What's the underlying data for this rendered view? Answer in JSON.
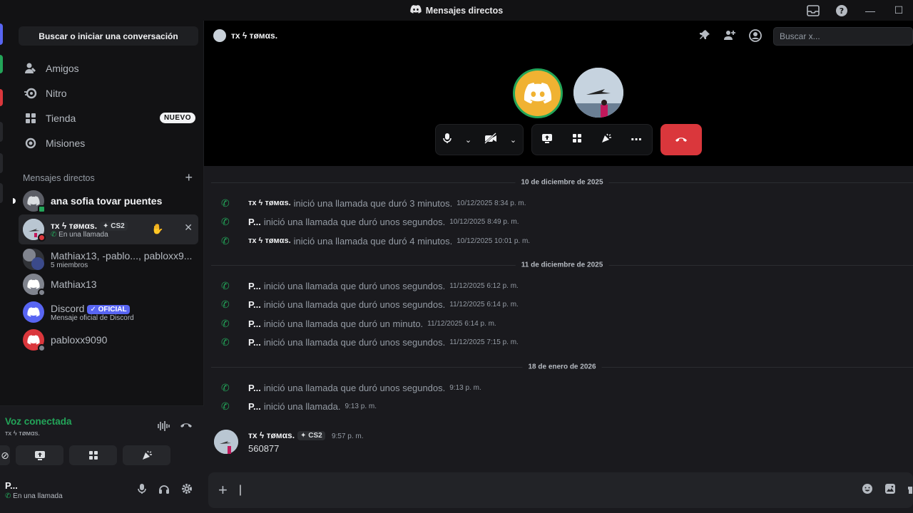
{
  "window": {
    "title": "Mensajes directos"
  },
  "sidebar": {
    "search_label": "Buscar o iniciar una conversación",
    "nav": [
      {
        "label": "Amigos",
        "icon": "friends-icon"
      },
      {
        "label": "Nitro",
        "icon": "nitro-icon"
      },
      {
        "label": "Tienda",
        "icon": "shop-icon",
        "badge": "NUEVO"
      },
      {
        "label": "Misiones",
        "icon": "quests-icon"
      }
    ],
    "dm_header": "Mensajes directos",
    "dms": [
      {
        "name": "ana sofia tovar puentes",
        "status_color": "#23a559"
      },
      {
        "name": "тx ϟ тøмαѕ.",
        "tag": "CS2",
        "sub": "En una llamada",
        "status_color": "#da373c"
      },
      {
        "name": "Mathiax13, -pablo..., pabloxx9...",
        "sub": "5 miembros"
      },
      {
        "name": "Mathiax13",
        "status_color": "#80848e"
      },
      {
        "name": "Discord",
        "tag": "OFICIAL",
        "sub": "Mensaje oficial de Discord"
      },
      {
        "name": "pabloxx9090",
        "status_color": "#80848e"
      }
    ]
  },
  "voice": {
    "title": "Voz conectada",
    "channel": "тx ϟ тøмαѕ."
  },
  "user": {
    "name": "P...",
    "status": "En una llamada"
  },
  "header": {
    "name": "тx ϟ тøмαѕ.",
    "search_placeholder": "Buscar x..."
  },
  "messages": {
    "dates": [
      "10 de diciembre de 2025",
      "11 de diciembre de 2025",
      "18 de enero de 2026"
    ],
    "calls": [
      {
        "who": "тx ϟ тøмαѕ.",
        "text": "inició una llamada que duró 3 minutos.",
        "ts": "10/12/2025 8:34 p. m."
      },
      {
        "who": "P...",
        "text": "inició una llamada que duró unos segundos.",
        "ts": "10/12/2025 8:49 p. m."
      },
      {
        "who": "тx ϟ тøмαѕ.",
        "text": "inició una llamada que duró 4 minutos.",
        "ts": "10/12/2025 10:01 p. m."
      },
      {
        "who": "P...",
        "text": "inició una llamada que duró unos segundos.",
        "ts": "11/12/2025 6:12 p. m."
      },
      {
        "who": "P...",
        "text": "inició una llamada que duró unos segundos.",
        "ts": "11/12/2025 6:14 p. m."
      },
      {
        "who": "P...",
        "text": "inició una llamada que duró un minuto.",
        "ts": "11/12/2025 6:14 p. m."
      },
      {
        "who": "P...",
        "text": "inició una llamada que duró unos segundos.",
        "ts": "11/12/2025 7:15 p. m."
      },
      {
        "who": "P...",
        "text": "inició una llamada que duró unos segundos.",
        "ts": "9:13 p. m."
      },
      {
        "who": "P...",
        "text": "inició una llamada.",
        "ts": "9:13 p. m."
      }
    ],
    "last": {
      "author": "тx ϟ тøмαѕ.",
      "tag": "CS2",
      "ts": "9:57 p. m.",
      "body": "560877"
    }
  },
  "colors": {
    "accent": "#5865f2",
    "green": "#23a559",
    "red": "#da373c",
    "discord_orange": "#f0b232"
  }
}
